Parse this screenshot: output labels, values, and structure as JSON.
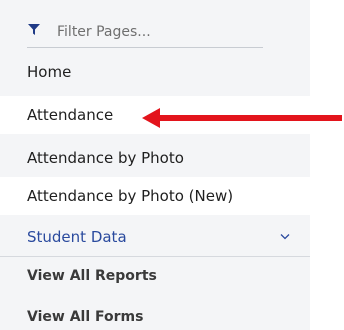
{
  "filter": {
    "placeholder": "Filter Pages...",
    "icon": "filter-icon"
  },
  "nav": {
    "home": "Home",
    "attendance": "Attendance",
    "attendance_by_photo": "Attendance by Photo",
    "attendance_by_photo_new": "Attendance by Photo (New)",
    "student_data": "Student Data",
    "view_all_reports": "View All Reports",
    "view_all_forms": "View All Forms"
  },
  "colors": {
    "accent_blue": "#2a4a9e",
    "annotation_red": "#e3141c"
  }
}
